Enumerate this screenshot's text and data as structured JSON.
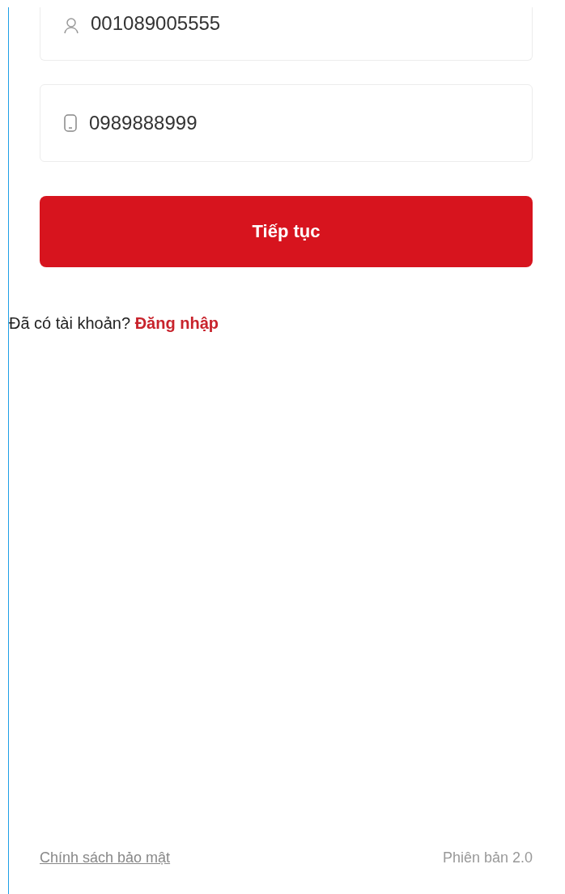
{
  "fields": [
    {
      "kind": "user",
      "value": "001089005555"
    },
    {
      "kind": "phone",
      "value": "0989888999"
    }
  ],
  "continue_button": "Tiếp tục",
  "login_prompt": {
    "text": "Đã có tài khoản?",
    "link": "Đăng nhập"
  },
  "footer": {
    "privacy_link": "Chính sách bảo mật",
    "version": "Phiên bản 2.0"
  }
}
